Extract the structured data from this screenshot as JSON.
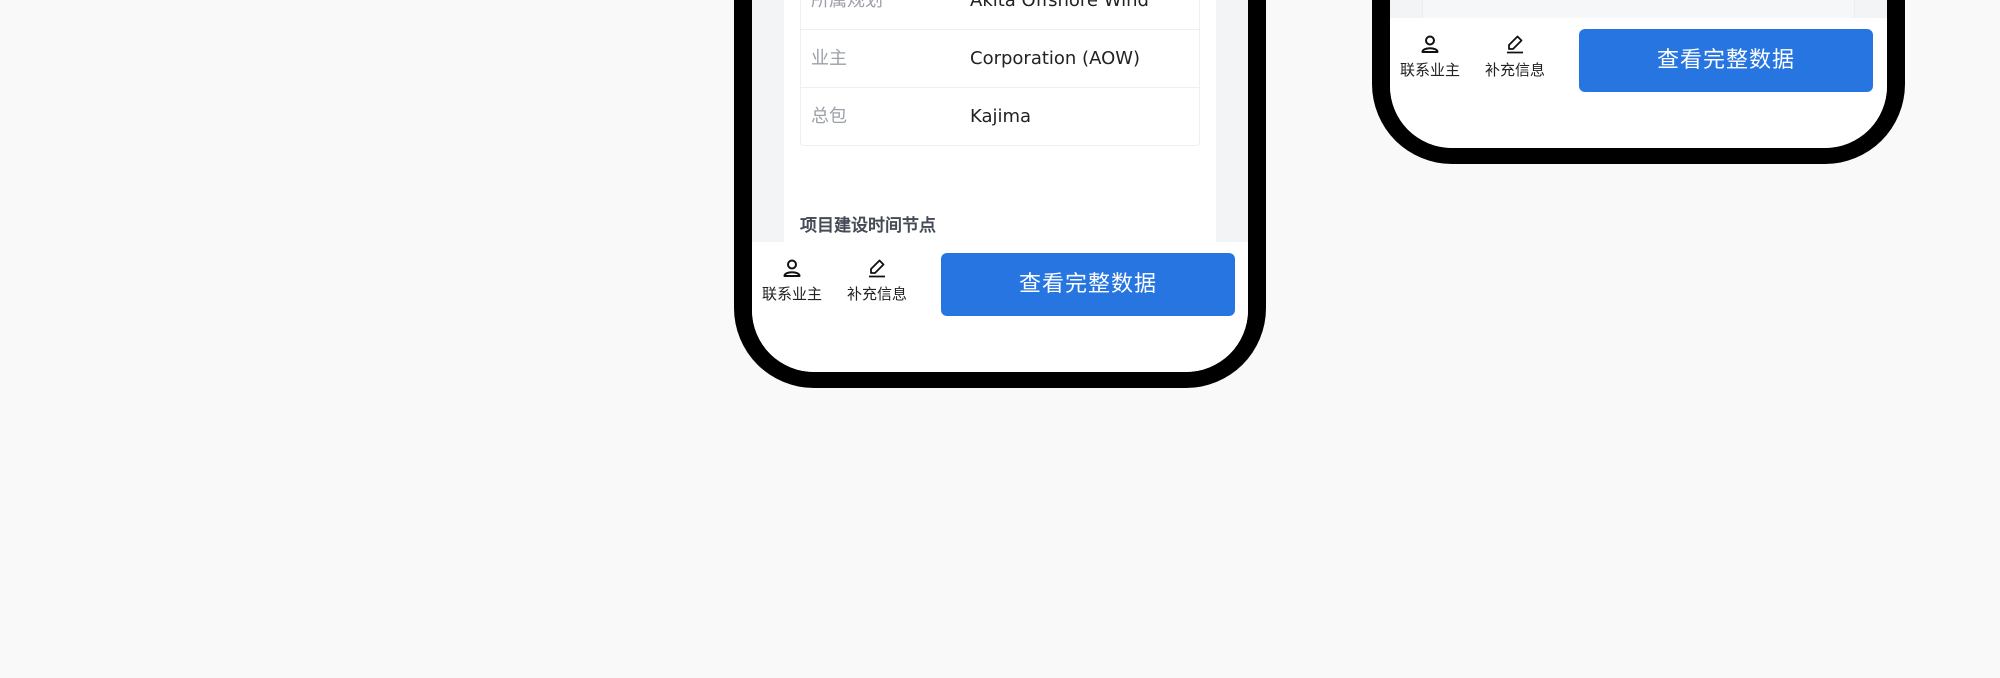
{
  "left_phone": {
    "info_rows": [
      {
        "label": "所属规划",
        "value": "Akita Offshore Wind"
      },
      {
        "label": "业主",
        "value": "Corporation (AOW)"
      },
      {
        "label": "总包",
        "value": "Kajima"
      }
    ],
    "section_heading": "项目建设时间节点"
  },
  "action_bar": {
    "contact_label": "联系业主",
    "contact_icon": "user-icon",
    "supplement_label": "补充信息",
    "supplement_icon": "pencil-icon",
    "primary_label": "查看完整数据"
  },
  "colors": {
    "primary": "#2775e0",
    "page_background": "#f9f9f9"
  }
}
